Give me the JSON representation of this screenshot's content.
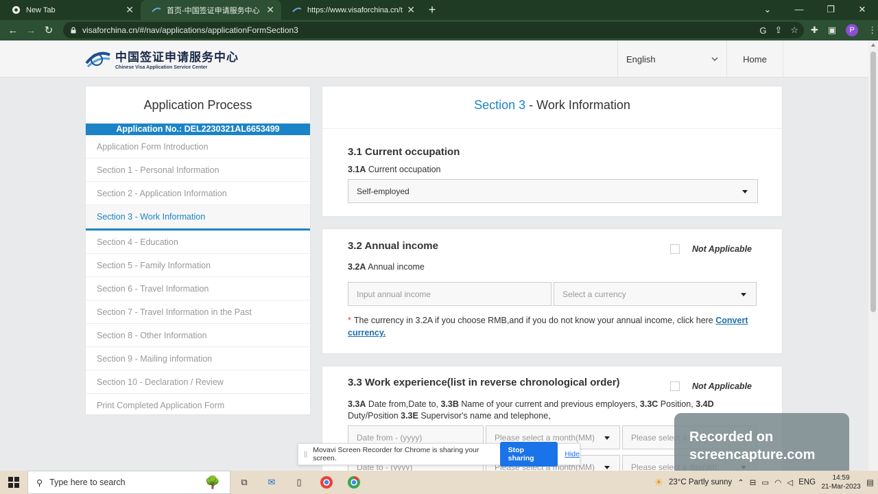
{
  "browser": {
    "tabs": [
      {
        "title": "New Tab",
        "icon": "chrome-icon"
      },
      {
        "title": "首页-中国签证申请服务中心",
        "icon": "visa-logo-icon"
      },
      {
        "title": "https://www.visaforchina.cn/tem",
        "icon": "visa-logo-icon"
      }
    ],
    "url": "visaforchina.cn/#/nav/applications/applicationFormSection3",
    "profile_initial": "P"
  },
  "site": {
    "logo_cn": "中国签证申请服务中心",
    "logo_en": "Chinese Visa Application Service Center",
    "language": "English",
    "home": "Home",
    "brand_color": "#1c84c6"
  },
  "sidebar": {
    "title": "Application Process",
    "application_no": "Application No.: DEL2230321AL6653499",
    "items": [
      {
        "label": "Application Form Introduction",
        "active": false
      },
      {
        "label": "Section 1 - Personal Information",
        "active": false
      },
      {
        "label": "Section 2 - Application Information",
        "active": false
      },
      {
        "label": "Section 3 - Work Information",
        "active": true
      },
      {
        "label": "Section 4 - Education",
        "active": false
      },
      {
        "label": "Section 5 - Family Information",
        "active": false
      },
      {
        "label": "Section 6 - Travel Information",
        "active": false
      },
      {
        "label": "Section 7 - Travel Information in the Past",
        "active": false
      },
      {
        "label": "Section 8 - Other Information",
        "active": false
      },
      {
        "label": "Section 9 - Mailing information",
        "active": false
      },
      {
        "label": "Section 10 - Declaration / Review",
        "active": false
      },
      {
        "label": "Print Completed Application Form",
        "active": false
      }
    ]
  },
  "main": {
    "section_num": "Section 3",
    "section_rest": " - Work Information",
    "q31": {
      "title": "3.1 Current occupation",
      "sub_code": "3.1A",
      "sub_label": " Current occupation",
      "value": "Self-employed"
    },
    "q32": {
      "title": "3.2 Annual income",
      "not_applicable": "Not Applicable",
      "sub_code": "3.2A",
      "sub_label": " Annual income",
      "income_placeholder": "Input annual income",
      "currency_placeholder": "Select a currency",
      "note": "The currency in 3.2A if you choose RMB,and if you do not know your annual income, click here ",
      "note_link": "Convert currency."
    },
    "q33": {
      "title": "3.3 Work experience(list in reverse chronological order)",
      "not_applicable": "Not Applicable",
      "desc_a": "3.3A",
      "desc_a_text": " Date from,Date to, ",
      "desc_b": "3.3B",
      "desc_b_text": " Name of your current and previous employers, ",
      "desc_c": "3.3C",
      "desc_c_text": " Position, ",
      "desc_d": "3.4D",
      "desc_d_text": " Duty/Position ",
      "desc_e": "3.3E",
      "desc_e_text": " Supervisor's name and telephone,",
      "date_from": "Date from - (yyyy)",
      "month1": "Please select a month(MM)",
      "day1": "Please select a day(dd)",
      "date_to": "Date to - (yyyy)",
      "month2": "Please select a month(MM)",
      "day2": "Please select a day(dd)"
    }
  },
  "sharing": {
    "message": "Movavi Screen Recorder for Chrome is sharing your screen.",
    "stop": "Stop sharing",
    "hide": "Hide"
  },
  "watermark": {
    "line1": "Recorded on",
    "line2": "screencapture.com"
  },
  "taskbar": {
    "search_placeholder": "Type here to search",
    "weather": "23°C  Partly sunny",
    "lang": "ENG",
    "time": "14:59",
    "date": "21-Mar-2023"
  }
}
